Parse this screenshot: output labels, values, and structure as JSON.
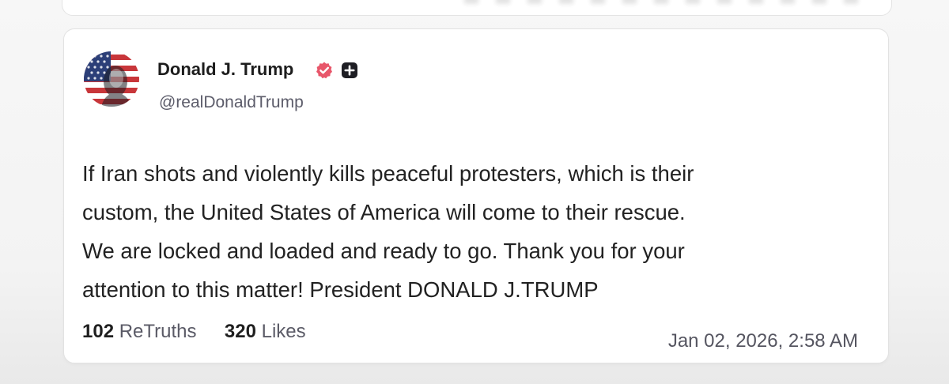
{
  "post": {
    "author_name": "Donald J. Trump",
    "handle": "@realDonaldTrump",
    "verified_icon": "verified-check-icon",
    "badge_icon": "plus-badge-icon",
    "lines": [
      "If Iran shots and violently kills peaceful protesters, which is their",
      "custom, the United States of America will come to their rescue.",
      "We are locked and loaded and ready to go. Thank you for your",
      "attention to this matter! President DONALD J.TRUMP"
    ],
    "retruths_count": "102",
    "retruths_label": "ReTruths",
    "likes_count": "320",
    "likes_label": "Likes",
    "timestamp": "Jan 02, 2026, 2:58 AM"
  },
  "colors": {
    "verified": "#e8566a",
    "badge": "#1e1e24",
    "text": "#222222",
    "muted": "#5a5a66"
  }
}
